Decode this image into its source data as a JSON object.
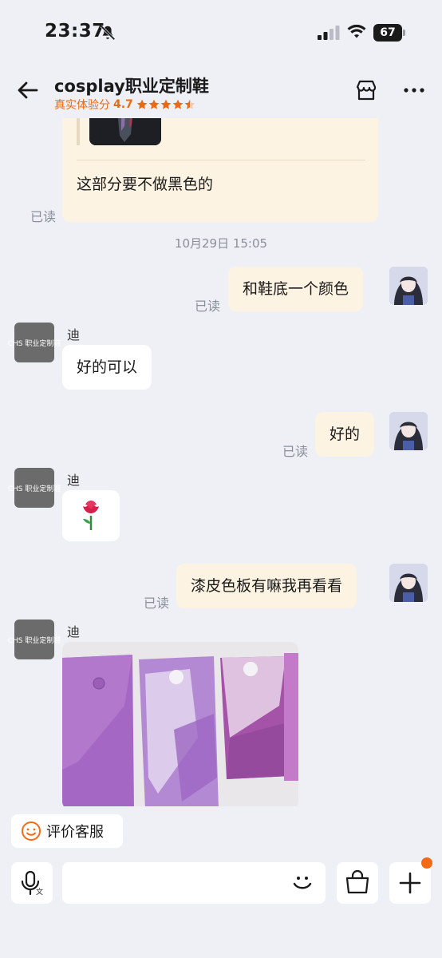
{
  "status_bar": {
    "time": "23:37",
    "battery": "67"
  },
  "header": {
    "title": "cosplay职业定制鞋",
    "rating_label": "真实体验分",
    "rating_score": "4.7",
    "stars": 4.5
  },
  "chat": {
    "quote_text": "这部分要不做黑色的",
    "timestamp": "10月29日 15:05",
    "messages": [
      {
        "from": "me",
        "text": "和鞋底一个颜色",
        "status": "已读"
      },
      {
        "from": "shop",
        "sender": "迪",
        "text": "好的可以"
      },
      {
        "from": "me",
        "text": "好的",
        "status": "已读"
      },
      {
        "from": "shop",
        "sender": "迪",
        "sticker": "rose"
      },
      {
        "from": "me",
        "text": "漆皮色板有嘛我再看看",
        "status": "已读"
      },
      {
        "from": "shop",
        "sender": "迪",
        "image": "purple-patent-leather-samples"
      }
    ],
    "first_read": "已读",
    "shop_avatar_text": "CHS 职业定制鞋"
  },
  "bottom": {
    "rate_label": "评价客服",
    "input_placeholder": ""
  },
  "colors": {
    "accent": "#f56a14",
    "bubble_mine": "#fdf3e2",
    "background": "#eef0f6"
  }
}
